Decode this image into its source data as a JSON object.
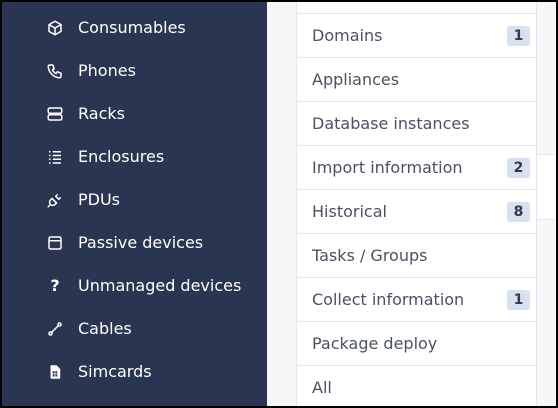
{
  "sidebar": {
    "items": [
      {
        "label": "Consumables",
        "icon": "box-icon"
      },
      {
        "label": "Phones",
        "icon": "phone-icon"
      },
      {
        "label": "Racks",
        "icon": "server-icon"
      },
      {
        "label": "Enclosures",
        "icon": "enclosure-icon"
      },
      {
        "label": "PDUs",
        "icon": "plug-icon"
      },
      {
        "label": "Passive devices",
        "icon": "window-icon"
      },
      {
        "label": "Unmanaged devices",
        "icon": "question-icon"
      },
      {
        "label": "Cables",
        "icon": "cable-icon"
      },
      {
        "label": "Simcards",
        "icon": "simcard-icon"
      }
    ],
    "question_glyph": "?"
  },
  "menu": {
    "items": [
      {
        "label": "Domains",
        "badge": "1"
      },
      {
        "label": "Appliances",
        "badge": ""
      },
      {
        "label": "Database instances",
        "badge": ""
      },
      {
        "label": "Import information",
        "badge": "2"
      },
      {
        "label": "Historical",
        "badge": "8"
      },
      {
        "label": "Tasks / Groups",
        "badge": ""
      },
      {
        "label": "Collect information",
        "badge": "1"
      },
      {
        "label": "Package deploy",
        "badge": ""
      },
      {
        "label": "All",
        "badge": ""
      }
    ]
  },
  "colors": {
    "sidebar_bg": "#2a3651",
    "badge_bg": "#d8e0f2",
    "text": "#4a5262"
  }
}
